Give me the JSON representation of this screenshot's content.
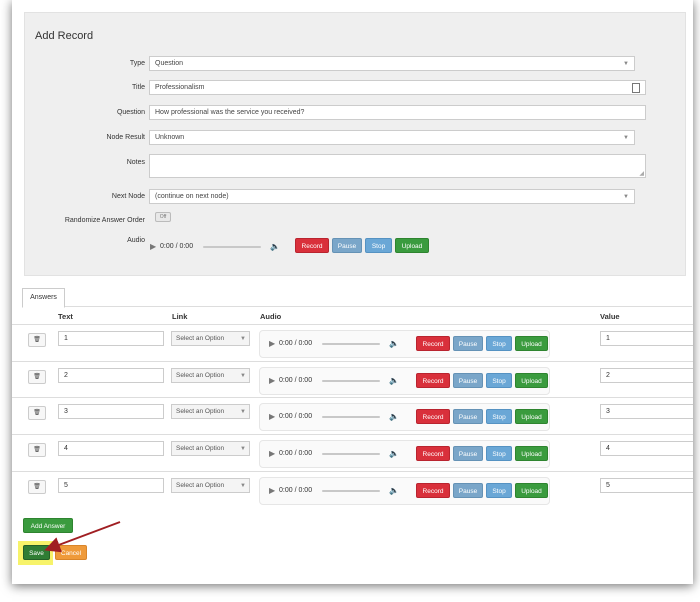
{
  "form": {
    "title": "Add Record",
    "type_label": "Type",
    "type_value": "Question",
    "title_label": "Title",
    "title_value": "Professionalism",
    "question_label": "Question",
    "question_value": "How professional was the service you received?",
    "node_result_label": "Node Result",
    "node_result_value": "Unknown",
    "notes_label": "Notes",
    "notes_value": "",
    "next_node_label": "Next Node",
    "next_node_value": "(continue on next node)",
    "randomize_label": "Randomize Answer Order",
    "randomize_toggle": "Off",
    "audio_label": "Audio",
    "audio_time": "0:00 / 0:00"
  },
  "audio_buttons": {
    "record": "Record",
    "pause": "Pause",
    "stop": "Stop",
    "upload": "Upload"
  },
  "answers": {
    "tab_label": "Answers",
    "columns": {
      "text": "Text",
      "link": "Link",
      "audio": "Audio",
      "value": "Value"
    },
    "link_placeholder": "Select an Option",
    "rows": [
      {
        "text": "1",
        "time": "0:00 / 0:00",
        "value": "1"
      },
      {
        "text": "2",
        "time": "0:00 / 0:00",
        "value": "2"
      },
      {
        "text": "3",
        "time": "0:00 / 0:00",
        "value": "3"
      },
      {
        "text": "4",
        "time": "0:00 / 0:00",
        "value": "4"
      },
      {
        "text": "5",
        "time": "0:00 / 0:00",
        "value": "5"
      }
    ]
  },
  "actions": {
    "add_answer": "Add Answer",
    "save": "Save",
    "cancel": "Cancel"
  },
  "icons": {
    "caret": "chevron-down-icon",
    "trash": "trash-icon",
    "play": "play-icon",
    "volume": "volume-icon",
    "calendar": "field-icon"
  },
  "colors": {
    "record": "#d9303b",
    "pause": "#7aa6c9",
    "stop": "#6aa7d6",
    "upload": "#3a9b3e",
    "save": "#2f7d34",
    "cancel": "#ef9a3a",
    "highlight": "#f7f36a",
    "annotation_arrow": "#a01e22"
  }
}
